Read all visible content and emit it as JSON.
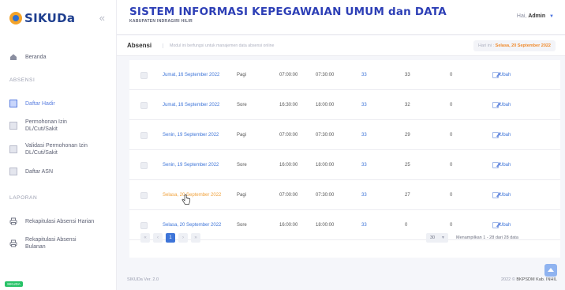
{
  "brand": {
    "name": "SIKUDa",
    "collapse_icon": "«"
  },
  "sidebar": {
    "home_label": "Beranda",
    "section_absensi": "ABSENSI",
    "section_laporan": "LAPORAN",
    "items": [
      {
        "label": "Daftar Hadir"
      },
      {
        "label": "Permohonan Izin DL/Cuti/Sakit"
      },
      {
        "label": "Validasi Permohonan Izin DL/Cuti/Sakit"
      },
      {
        "label": "Daftar ASN"
      },
      {
        "label": "Rekapitulasi Absensi Harian"
      },
      {
        "label": "Rekapitulasi Absensi Bulanan"
      }
    ],
    "badge": "SIKUDA"
  },
  "header": {
    "title": "SISTEM INFORMASI KEPEGAWAIAN UMUM dan DATA",
    "subtitle": "KABUPATEN INDRAGIRI HILIR",
    "greeting": "Hai,",
    "user": "Admin"
  },
  "subheader": {
    "page_title": "Absensi",
    "description": "Modul ini berfungsi untuk manajemen data absensi online",
    "date_label": "Hari ini :",
    "date_value": "Selasa, 20 September 2022"
  },
  "table": {
    "edit_label": "Ubah",
    "rows": [
      {
        "date": "Jumat, 16 September 2022",
        "session": "Pagi",
        "start": "07:00:00",
        "end": "07:30:00",
        "total": "33",
        "present": "33",
        "absent": "0"
      },
      {
        "date": "Jumat, 16 September 2022",
        "session": "Sore",
        "start": "16:30:00",
        "end": "18:00:00",
        "total": "33",
        "present": "32",
        "absent": "0"
      },
      {
        "date": "Senin, 19 September 2022",
        "session": "Pagi",
        "start": "07:00:00",
        "end": "07:30:00",
        "total": "33",
        "present": "29",
        "absent": "0"
      },
      {
        "date": "Senin, 19 September 2022",
        "session": "Sore",
        "start": "16:00:00",
        "end": "18:00:00",
        "total": "33",
        "present": "25",
        "absent": "0"
      },
      {
        "date": "Selasa, 20 September 2022",
        "session": "Pagi",
        "start": "07:00:00",
        "end": "07:30:00",
        "total": "33",
        "present": "27",
        "absent": "0"
      },
      {
        "date": "Selasa, 20 September 2022",
        "session": "Sore",
        "start": "16:00:00",
        "end": "18:00:00",
        "total": "33",
        "present": "0",
        "absent": "0"
      }
    ]
  },
  "pagination": {
    "first": "«",
    "prev": "‹",
    "current": "1",
    "next": "›",
    "last": "»",
    "per_page": "30",
    "showing": "Menampilkan 1 - 28 dari 28 data"
  },
  "footer": {
    "version": "SIKUDa Ver. 2.0",
    "copyright_year": "2022 ©",
    "copyright_org": "BKPSDM Kab. INHIL"
  }
}
